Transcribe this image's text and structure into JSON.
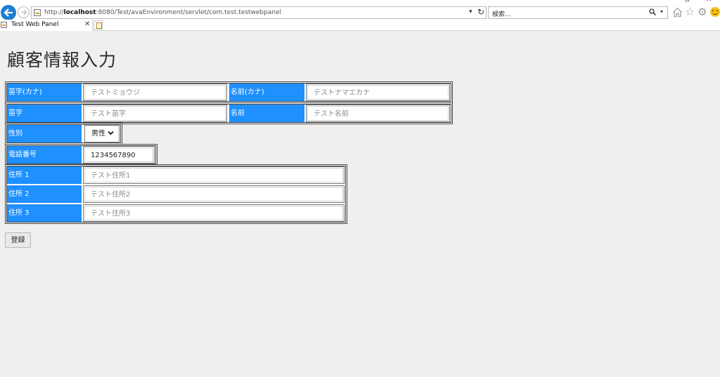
{
  "browser": {
    "url_prefix": "http://",
    "url_host": "localhost",
    "url_rest": ":8080/Test/avaEnvironment/servlet/com.test.testwebpanel",
    "search_placeholder": "検索...",
    "tab_title": "Test Web Panel"
  },
  "page": {
    "title": "顧客情報入力",
    "labels": {
      "last_name_kana": "苗字(カナ)",
      "first_name_kana": "名前(カナ)",
      "last_name": "苗字",
      "first_name": "名前",
      "gender": "性別",
      "phone": "電話番号",
      "address1": "住所 1",
      "address2": "住所 2",
      "address3": "住所 3"
    },
    "fields": {
      "last_name_kana": "テストミョウジ",
      "first_name_kana": "テストナマエカナ",
      "last_name": "テスト苗字",
      "first_name": "テスト名前",
      "gender_selected": "男性",
      "phone": "1234567890",
      "address1": "テスト住所1",
      "address2": "テスト住所2",
      "address3": "テスト住所3"
    },
    "register_label": "登録"
  }
}
